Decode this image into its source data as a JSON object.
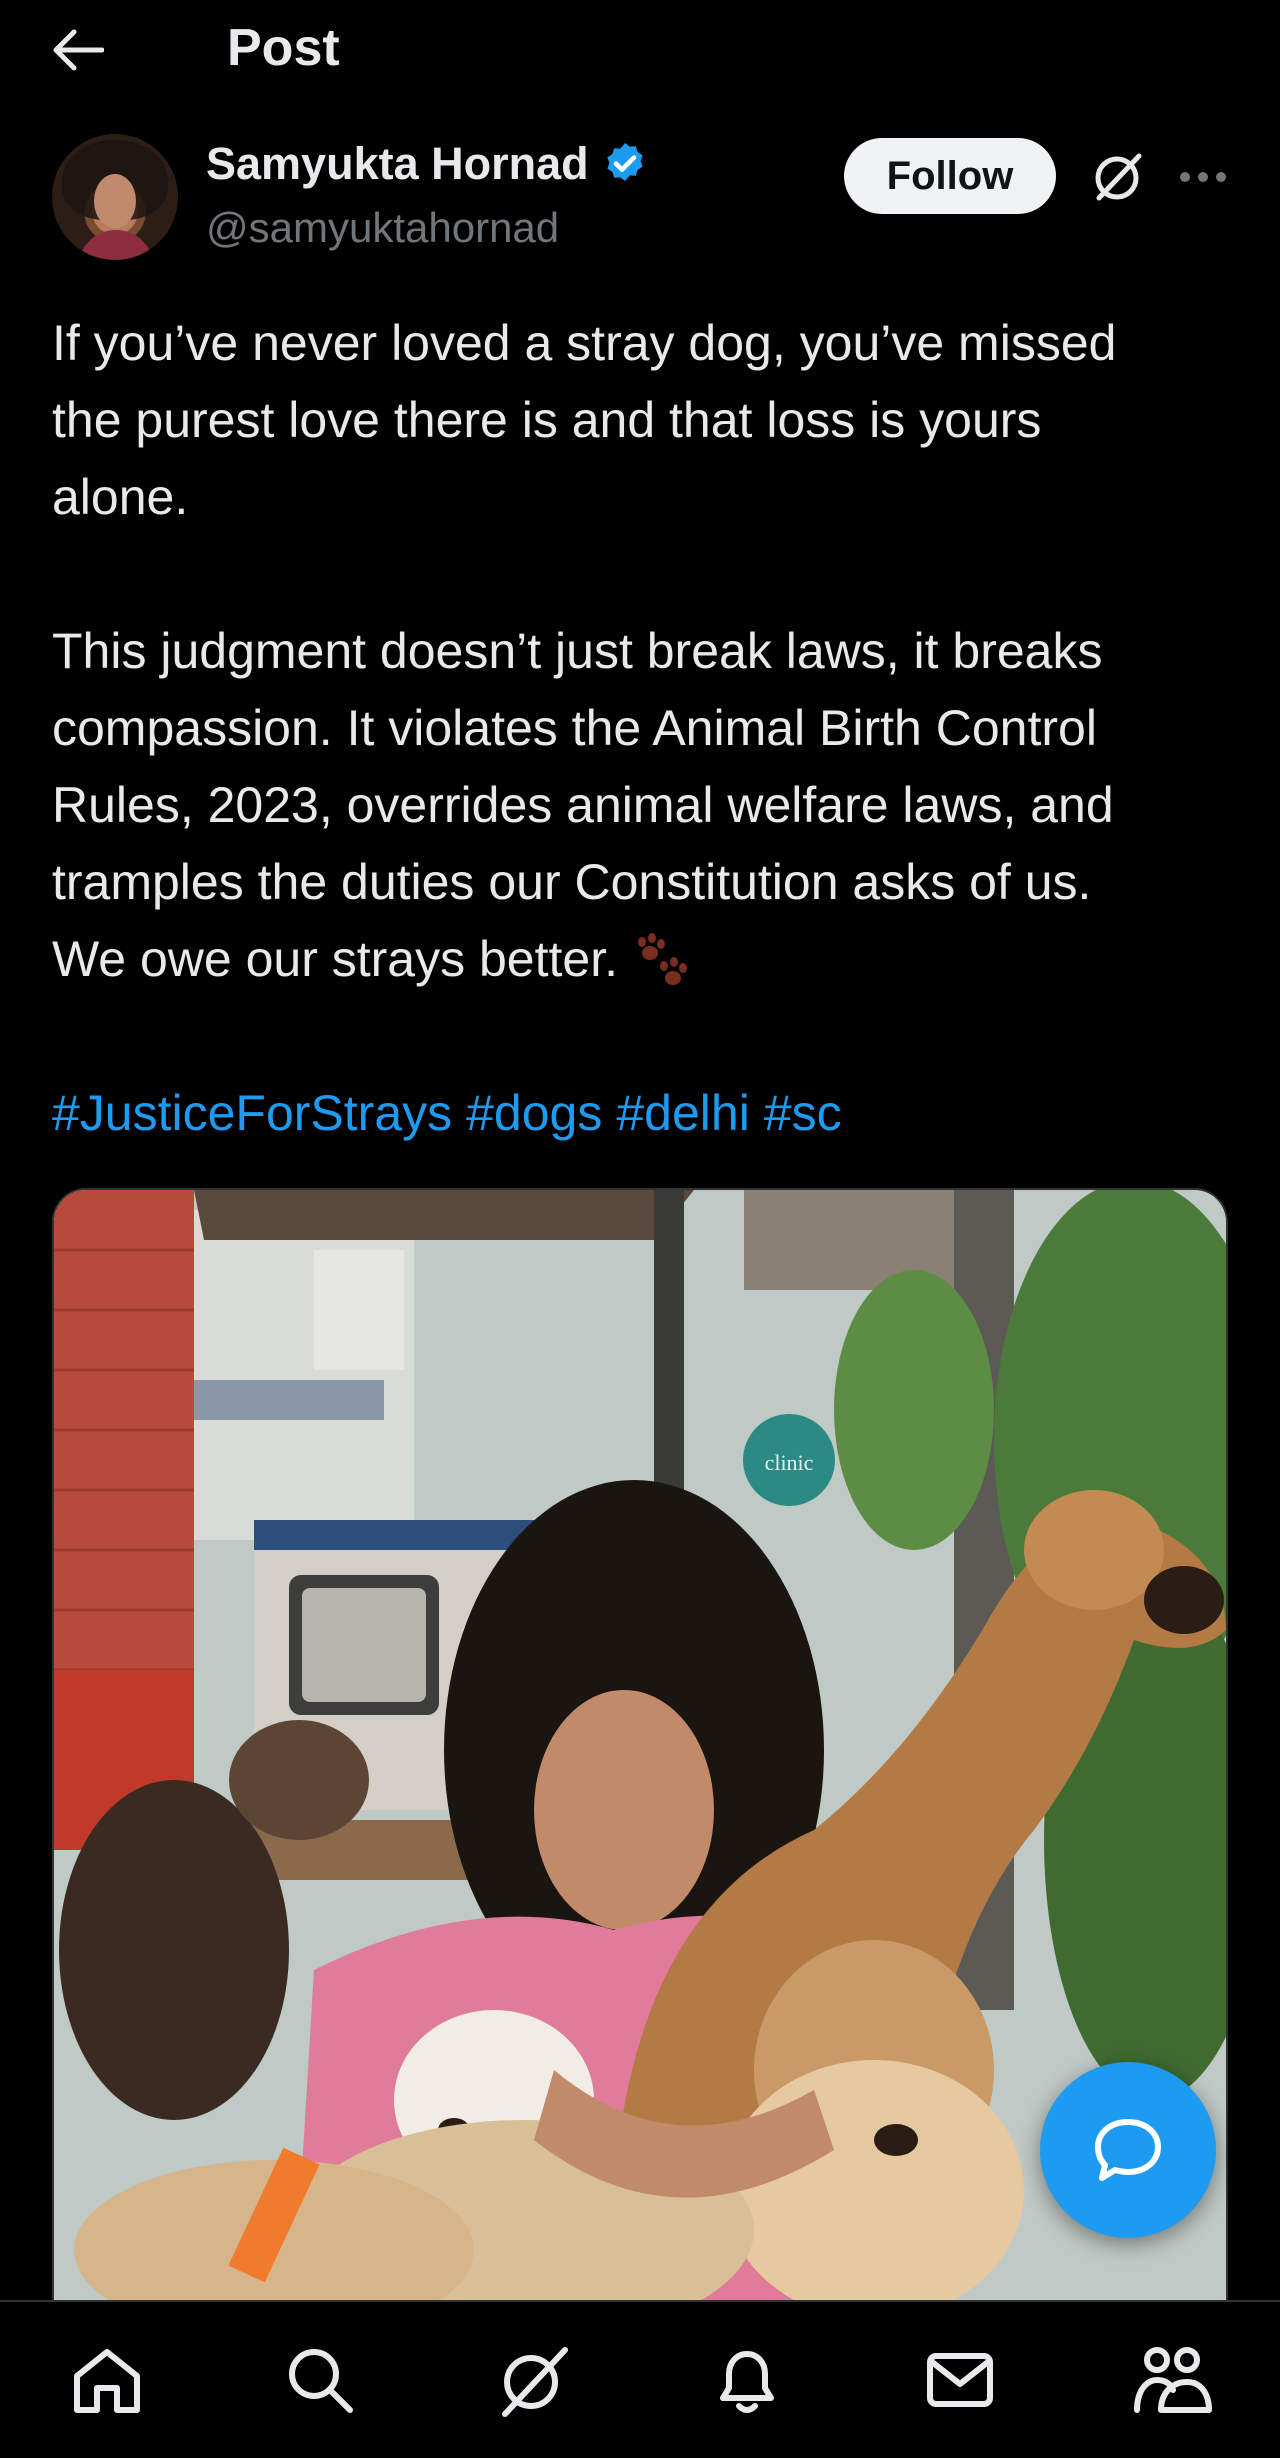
{
  "header": {
    "title": "Post",
    "back_icon": "arrow-left-icon"
  },
  "author": {
    "display_name": "Samyukta Hornad",
    "handle": "@samyuktahornad",
    "verified": true,
    "follow_label": "Follow",
    "grok_icon": "grok-icon",
    "more_icon": "more-horizontal-icon"
  },
  "tweet": {
    "lines_p1": [
      "If you’ve never loved a stray dog, you’ve missed",
      "the purest love there is and that loss is yours",
      "alone."
    ],
    "lines_p2": [
      "This judgment doesn’t just break laws, it breaks",
      "compassion. It violates the Animal Birth Control",
      "Rules, 2023, overrides animal welfare laws, and",
      "tramples the duties our Constitution asks of us.",
      "We owe our strays better."
    ],
    "emoji": "paw-prints-icon",
    "hashtags": [
      "#JusticeForStrays",
      "#dogs",
      "#delhi",
      "#sc"
    ]
  },
  "media": {
    "sign_text": "clinic"
  },
  "fab": {
    "icon": "reply-bubble-icon"
  },
  "nav": {
    "items": [
      "home-icon",
      "search-icon",
      "grok-icon",
      "notifications-icon",
      "messages-icon",
      "communities-icon"
    ]
  },
  "colors": {
    "background": "#000000",
    "text": "#e7e9ea",
    "secondary": "#71767b",
    "accent": "#1d9bf0"
  }
}
